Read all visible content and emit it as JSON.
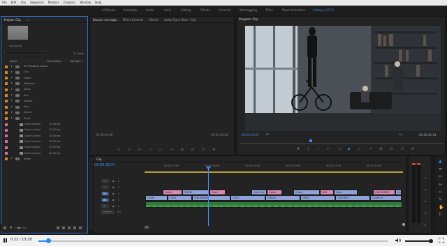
{
  "menubar": [
    "File",
    "Edit",
    "Clip",
    "Sequence",
    "Markers",
    "Graphics",
    "Window",
    "Help"
  ],
  "workspaces": [
    "All Panels",
    "Assembly",
    "Audio",
    "Color",
    "Editing",
    "Effects",
    "Libraries",
    "Metalogging",
    "Titles",
    "Paper Animation",
    "Editing (CS5.5)"
  ],
  "project": {
    "tab": "Project: Clip",
    "project_name": "Clip.prproj",
    "item_count": "17 Items",
    "columns": {
      "name": "Name",
      "frame_rate": "Frame Rate",
      "log": "Log Note"
    },
    "items": [
      {
        "name": "All Metadata Assets",
        "fr": "",
        "color": "#d08a2c",
        "type": "bin"
      },
      {
        "name": "Clip",
        "fr": "",
        "color": "#d08a2c",
        "type": "bin"
      },
      {
        "name": "Graph",
        "fr": "",
        "color": "#d08a2c",
        "type": "bin"
      },
      {
        "name": "Multicam",
        "fr": "",
        "color": "#d08a2c",
        "type": "bin"
      },
      {
        "name": "Music",
        "fr": "",
        "color": "#d08a2c",
        "type": "bin"
      },
      {
        "name": "Pics",
        "fr": "",
        "color": "#d08a2c",
        "type": "bin"
      },
      {
        "name": "Scenes",
        "fr": "",
        "color": "#d08a2c",
        "type": "bin"
      },
      {
        "name": "Seq",
        "fr": "",
        "color": "#d08a2c",
        "type": "bin"
      },
      {
        "name": "Sound",
        "fr": "",
        "color": "#d08a2c",
        "type": "bin"
      },
      {
        "name": "Stock",
        "fr": "",
        "color": "#d08a2c",
        "type": "bin"
      },
      {
        "name": "Cover Locked",
        "fr": "25,00 fps",
        "color": "#e06b9c",
        "type": "clip"
      },
      {
        "name": "Cover Locked",
        "fr": "25,00 fps",
        "color": "#e06b9c",
        "type": "clip"
      },
      {
        "name": "Cover Locked",
        "fr": "25,00 fps",
        "color": "#e06b9c",
        "type": "clip"
      },
      {
        "name": "Cover Locked",
        "fr": "25,00 fps",
        "color": "#e06b9c",
        "type": "clip"
      },
      {
        "name": "Cover Locked",
        "fr": "25,00 fps",
        "color": "#e06b9c",
        "type": "clip"
      },
      {
        "name": "Cover Locked",
        "fr": "25,00 fps",
        "color": "#e06b9c",
        "type": "clip"
      },
      {
        "name": "Video",
        "fr": "",
        "color": "#d08a2c",
        "type": "bin"
      }
    ]
  },
  "source": {
    "tabs": [
      "Source: (no clips)",
      "Effect Controls",
      "Effects",
      "Audio Track Mixer: Clip"
    ],
    "tc_left": "00:00:00:00",
    "tc_right": "00:00:00:00",
    "controls": [
      "⊲",
      "⊳",
      "⇤",
      "◁",
      "▷",
      "⇥",
      "⊞",
      "⊟",
      "⊡",
      "✚"
    ]
  },
  "program": {
    "title": "Program: Clip",
    "timecode": "00:00:26:07",
    "fit": "Fit",
    "scale": "1/4",
    "duration": "00:00:45:04",
    "controls": [
      "▼",
      "{",
      "}",
      "⇤",
      "◁",
      "▶",
      "▷",
      "⇥",
      "⊞",
      "⊟",
      "⊡",
      "✚"
    ]
  },
  "timeline": {
    "tab": "Clip",
    "timecode": "00:00:30:07",
    "ruler": [
      "00:00:15:00",
      "00:00:30:00",
      "00:00:45:00",
      "00:01:00:00",
      "00:01:15:00",
      "00:01:30:00"
    ],
    "tracks": [
      "V3",
      "V2",
      "V1",
      "A1",
      "A2",
      "Master"
    ],
    "master_value": "0,0",
    "clips": {
      "v2": [
        "Cover",
        "CD011",
        "Cove",
        "Cover Lo",
        "Cover",
        "Cover",
        "CD1",
        "Cove",
        "CD016.MP4",
        "Cover"
      ],
      "v1": [
        "Cover",
        "CD01",
        "CD018.MP4",
        "CD01",
        "CD016",
        "CD01",
        "CD018.M",
        "Cover Lo"
      ]
    }
  },
  "meter_scale": [
    "0",
    "-12",
    "-24",
    "-36",
    "-48",
    "dB"
  ],
  "player": {
    "time": "0:22 / 13:28",
    "progress": 0.027
  }
}
